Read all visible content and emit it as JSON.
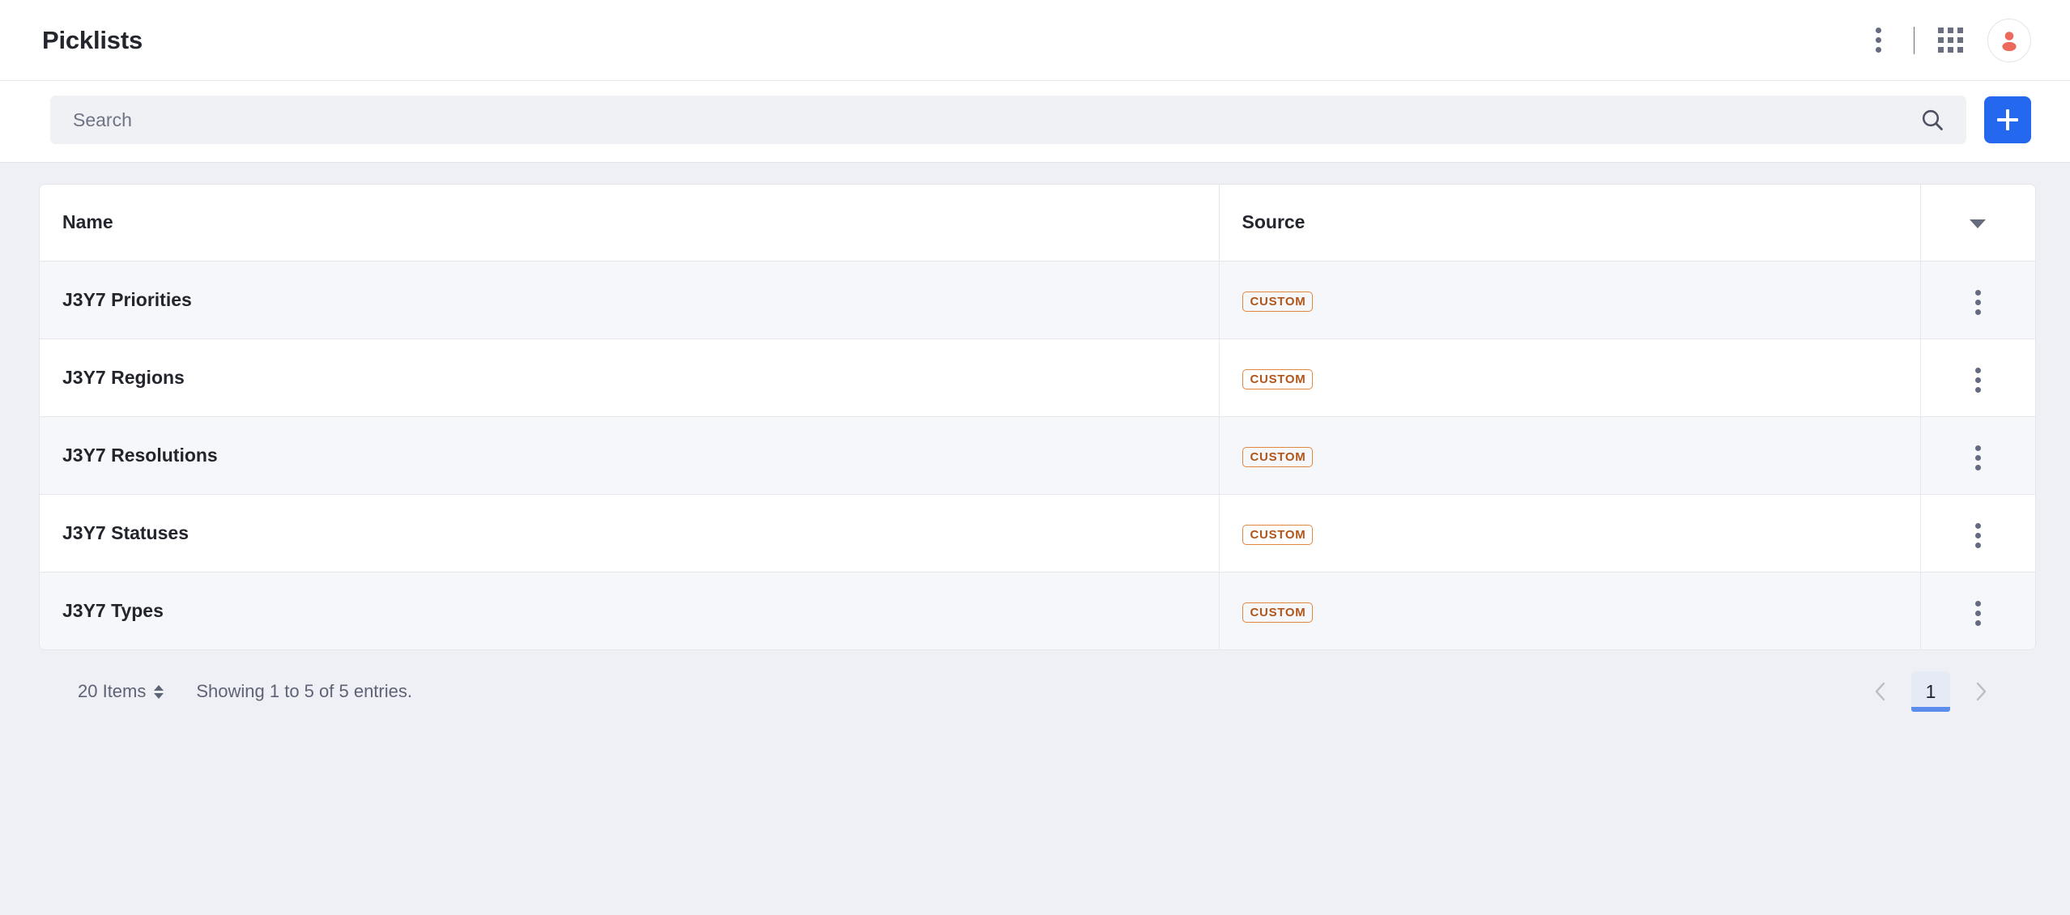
{
  "header": {
    "title": "Picklists",
    "more_menu_label": "More options",
    "apps_label": "Applications",
    "avatar_label": "User account"
  },
  "search": {
    "placeholder": "Search",
    "value": "",
    "search_icon": "search-icon",
    "add_label": "+"
  },
  "table": {
    "columns": [
      "Name",
      "Source"
    ],
    "rows": [
      {
        "name": "J3Y7 Priorities",
        "source": "CUSTOM"
      },
      {
        "name": "J3Y7 Regions",
        "source": "CUSTOM"
      },
      {
        "name": "J3Y7 Resolutions",
        "source": "CUSTOM"
      },
      {
        "name": "J3Y7 Statuses",
        "source": "CUSTOM"
      },
      {
        "name": "J3Y7 Types",
        "source": "CUSTOM"
      }
    ]
  },
  "footer": {
    "items_per_page": "20 Items",
    "showing": "Showing 1 to 5 of 5 entries.",
    "current_page": "1",
    "prev_label": "Previous",
    "next_label": "Next"
  },
  "colors": {
    "accent_blue": "#2568f0",
    "badge_border": "#e2873f",
    "badge_text": "#b15518",
    "page_bg": "#eff0f5",
    "avatar": "#ec6a5c"
  }
}
